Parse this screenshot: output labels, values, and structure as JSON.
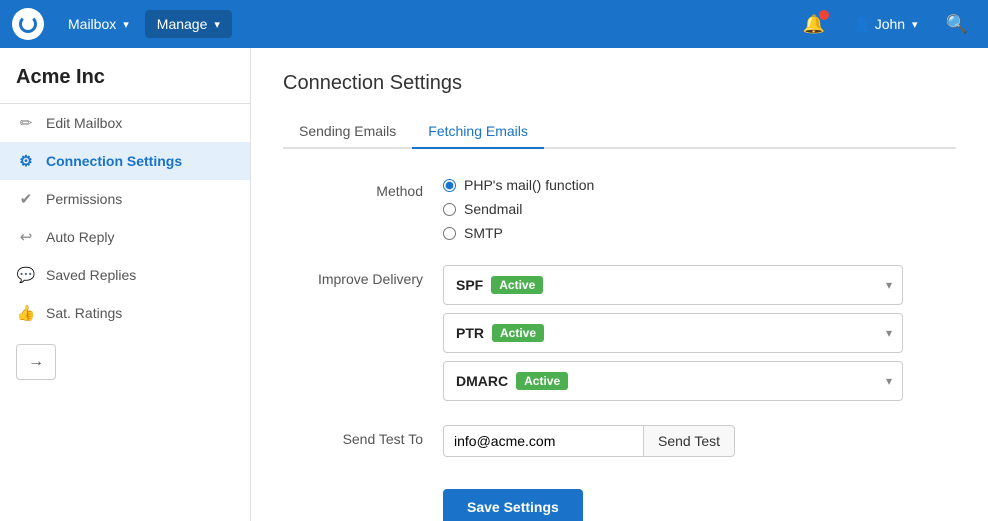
{
  "topnav": {
    "mailbox_label": "Mailbox",
    "manage_label": "Manage",
    "user_label": "John",
    "caret": "▾"
  },
  "sidebar": {
    "company_name": "Acme Inc",
    "items": [
      {
        "id": "edit-mailbox",
        "label": "Edit Mailbox",
        "icon": "✏"
      },
      {
        "id": "connection-settings",
        "label": "Connection Settings",
        "icon": "⚙",
        "active": true
      },
      {
        "id": "permissions",
        "label": "Permissions",
        "icon": "✔"
      },
      {
        "id": "auto-reply",
        "label": "Auto Reply",
        "icon": "↩"
      },
      {
        "id": "saved-replies",
        "label": "Saved Replies",
        "icon": "💬"
      },
      {
        "id": "sat-ratings",
        "label": "Sat. Ratings",
        "icon": "👍"
      }
    ],
    "arrow_button": "→"
  },
  "main": {
    "page_title": "Connection Settings",
    "tabs": [
      {
        "id": "sending",
        "label": "Sending Emails",
        "active": false
      },
      {
        "id": "fetching",
        "label": "Fetching Emails",
        "active": true
      }
    ],
    "method_label": "Method",
    "method_options": [
      {
        "id": "php-mail",
        "label": "PHP's mail() function",
        "checked": true
      },
      {
        "id": "sendmail",
        "label": "Sendmail",
        "checked": false
      },
      {
        "id": "smtp",
        "label": "SMTP",
        "checked": false
      }
    ],
    "improve_delivery_label": "Improve Delivery",
    "delivery_items": [
      {
        "id": "spf",
        "label": "SPF",
        "badge": "Active"
      },
      {
        "id": "ptr",
        "label": "PTR",
        "badge": "Active"
      },
      {
        "id": "dmarc",
        "label": "DMARC",
        "badge": "Active"
      }
    ],
    "send_test_label": "Send Test To",
    "send_test_placeholder": "info@acme.com",
    "send_test_value": "info@acme.com",
    "send_test_btn_label": "Send Test",
    "save_btn_label": "Save Settings"
  }
}
